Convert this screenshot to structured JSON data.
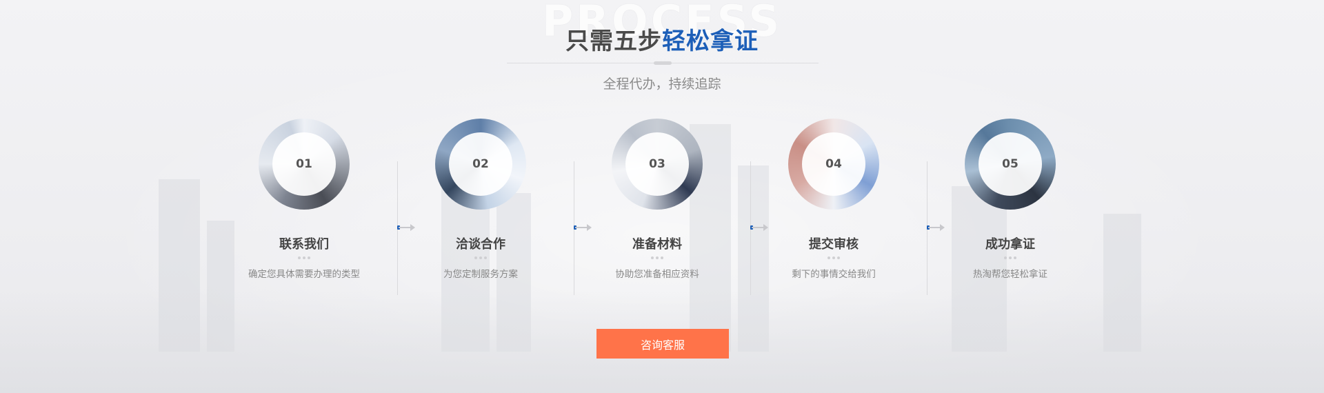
{
  "section": {
    "watermark": "PROCESS",
    "title_dark": "只需五步",
    "title_blue": "轻松拿证",
    "subtitle": "全程代办，持续追踪"
  },
  "steps": [
    {
      "number": "01",
      "name": "联系我们",
      "desc": "确定您具体需要办理的类型"
    },
    {
      "number": "02",
      "name": "洽谈合作",
      "desc": "为您定制服务方案"
    },
    {
      "number": "03",
      "name": "准备材料",
      "desc": "协助您准备相应资料"
    },
    {
      "number": "04",
      "name": "提交审核",
      "desc": "剩下的事情交给我们"
    },
    {
      "number": "05",
      "name": "成功拿证",
      "desc": "热淘帮您轻松拿证"
    }
  ],
  "cta": {
    "label": "咨询客服"
  },
  "colors": {
    "accent_blue": "#1d5fb8",
    "cta_orange": "#ff7349",
    "title_dark": "#4a4a4a"
  }
}
